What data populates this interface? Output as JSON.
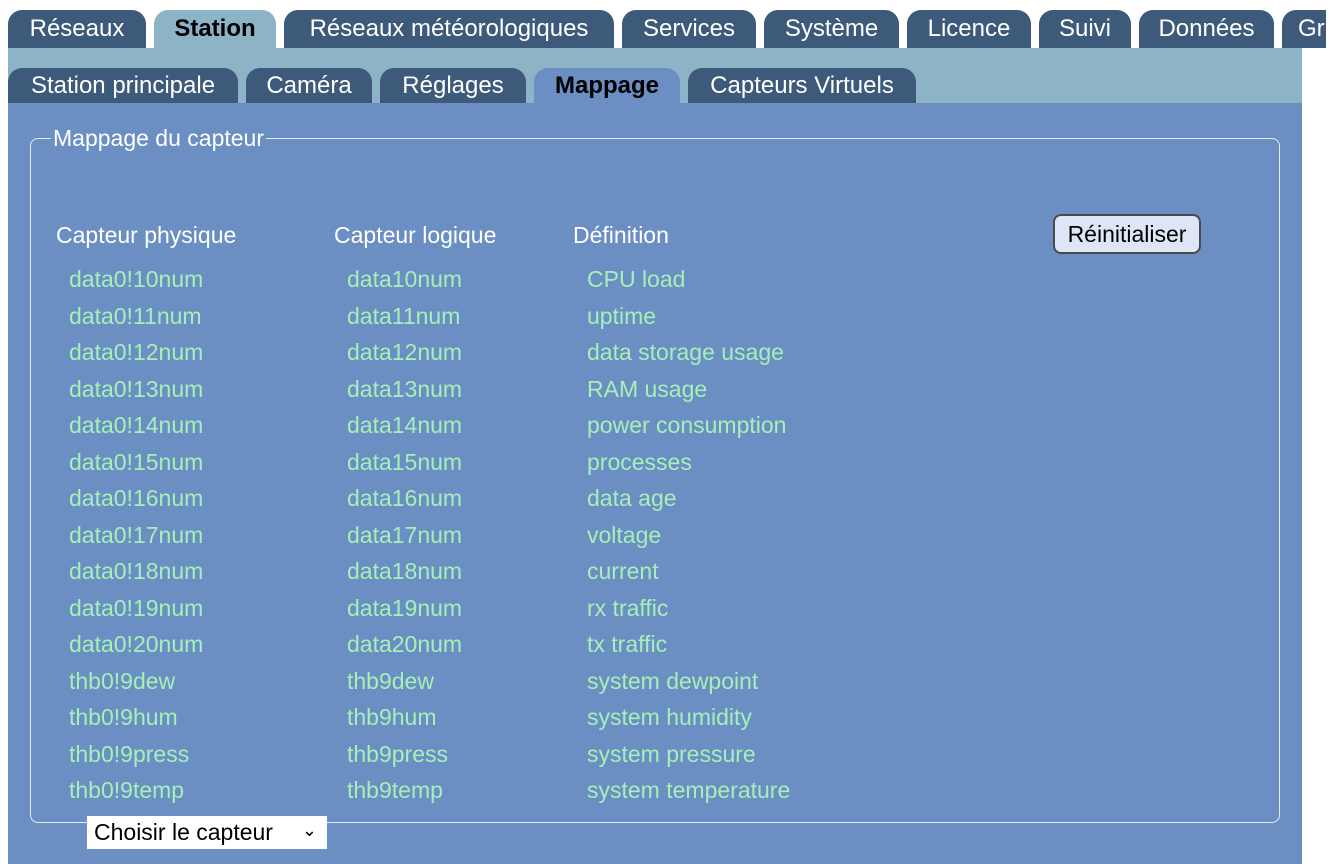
{
  "main_tabs": [
    {
      "label": "Réseaux",
      "active": false
    },
    {
      "label": "Station",
      "active": true
    },
    {
      "label": "Réseaux météorologiques",
      "active": false
    },
    {
      "label": "Services",
      "active": false
    },
    {
      "label": "Système",
      "active": false
    },
    {
      "label": "Licence",
      "active": false
    },
    {
      "label": "Suivi",
      "active": false
    },
    {
      "label": "Données",
      "active": false
    },
    {
      "label": "Gr",
      "active": false
    }
  ],
  "sub_tabs": [
    {
      "label": "Station principale",
      "active": false
    },
    {
      "label": "Caméra",
      "active": false
    },
    {
      "label": "Réglages",
      "active": false
    },
    {
      "label": "Mappage",
      "active": true
    },
    {
      "label": "Capteurs Virtuels",
      "active": false
    }
  ],
  "mapping": {
    "legend": "Mappage du capteur",
    "headers": {
      "physical": "Capteur physique",
      "logical": "Capteur logique",
      "definition": "Définition"
    },
    "reset_label": "Réinitialiser",
    "rows": [
      {
        "physical": "data0!10num",
        "logical": "data10num",
        "definition": "CPU load"
      },
      {
        "physical": "data0!11num",
        "logical": "data11num",
        "definition": "uptime"
      },
      {
        "physical": "data0!12num",
        "logical": "data12num",
        "definition": "data storage usage"
      },
      {
        "physical": "data0!13num",
        "logical": "data13num",
        "definition": "RAM usage"
      },
      {
        "physical": "data0!14num",
        "logical": "data14num",
        "definition": "power consumption"
      },
      {
        "physical": "data0!15num",
        "logical": "data15num",
        "definition": "processes"
      },
      {
        "physical": "data0!16num",
        "logical": "data16num",
        "definition": "data age"
      },
      {
        "physical": "data0!17num",
        "logical": "data17num",
        "definition": "voltage"
      },
      {
        "physical": "data0!18num",
        "logical": "data18num",
        "definition": "current"
      },
      {
        "physical": "data0!19num",
        "logical": "data19num",
        "definition": "rx traffic"
      },
      {
        "physical": "data0!20num",
        "logical": "data20num",
        "definition": "tx traffic"
      },
      {
        "physical": "thb0!9dew",
        "logical": "thb9dew",
        "definition": "system dewpoint"
      },
      {
        "physical": "thb0!9hum",
        "logical": "thb9hum",
        "definition": "system humidity"
      },
      {
        "physical": "thb0!9press",
        "logical": "thb9press",
        "definition": "system pressure"
      },
      {
        "physical": "thb0!9temp",
        "logical": "thb9temp",
        "definition": "system temperature"
      }
    ],
    "select": {
      "selected": "Choisir le capteur"
    }
  },
  "colors": {
    "tab_bg": "#3d5a7a",
    "tab_active_bg": "#8db3c6",
    "panel_bg": "#6b8fc3",
    "link_green": "#a6f0b8"
  }
}
